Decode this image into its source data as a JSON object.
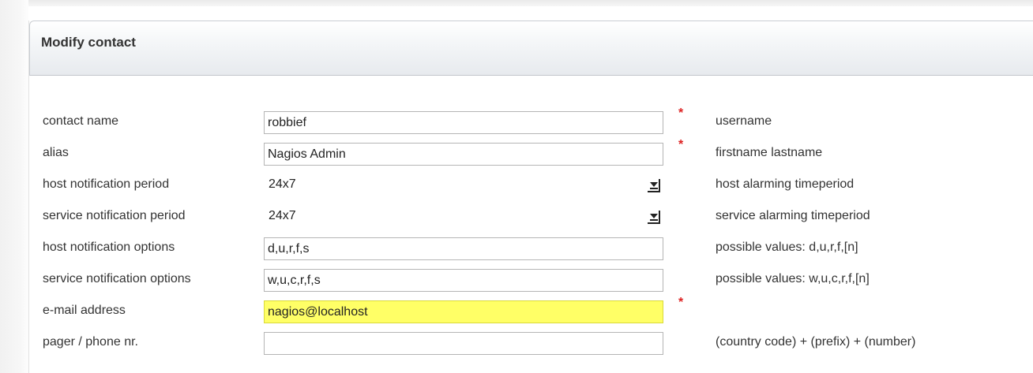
{
  "header": {
    "title": "Modify contact"
  },
  "form": {
    "rows": [
      {
        "label": "contact name",
        "value": "robbief",
        "required": "*",
        "hint": "username"
      },
      {
        "label": "alias",
        "value": "Nagios Admin",
        "required": "*",
        "hint": "firstname lastname"
      },
      {
        "label": "host notification period",
        "value": "24x7",
        "hint": "host alarming timeperiod"
      },
      {
        "label": "service notification period",
        "value": "24x7",
        "hint": "service alarming timeperiod"
      },
      {
        "label": "host notification options",
        "value": "d,u,r,f,s",
        "hint": "possible values: d,u,r,f,[n]"
      },
      {
        "label": "service notification options",
        "value": "w,u,c,r,f,s",
        "hint": "possible values: w,u,c,r,f,[n]"
      },
      {
        "label": "e-mail address",
        "value": "nagios@localhost",
        "required": "*",
        "hint": ""
      },
      {
        "label": "pager / phone nr.",
        "value": "",
        "hint": "(country code) + (prefix) + (number)"
      }
    ]
  },
  "colors": {
    "highlight": "#ffff66",
    "required": "#dd2222"
  },
  "icons": {
    "dropdown": "dropdown-arrow-icon"
  }
}
